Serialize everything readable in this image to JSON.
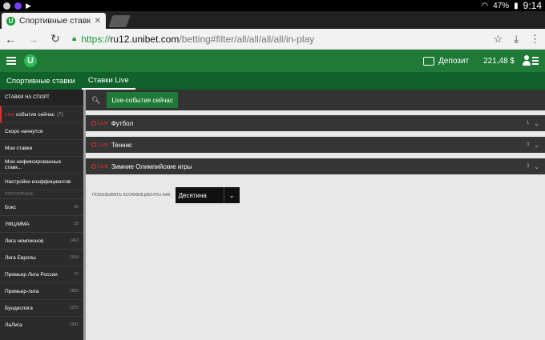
{
  "statusbar": {
    "battery": "47%",
    "time": "9:14"
  },
  "browser": {
    "tab_title": "Спортивные ставки U",
    "url_scheme": "https://",
    "url_host": "ru12.unibet.com",
    "url_path": "/betting#filter/all/all/all/all/in-play"
  },
  "app": {
    "logo": "U",
    "deposit_label": "Депозит",
    "balance": "221,48 $"
  },
  "subnav": {
    "items": [
      {
        "label": "Спортивные ставки"
      },
      {
        "label": "Ставки Live"
      }
    ]
  },
  "sidebar": {
    "header": "СТАВКИ НА СПОРТ",
    "live_prefix": "Live",
    "current_label": "события сейчас",
    "current_count": "(7)",
    "items": [
      {
        "label": "Скоро начнутся"
      },
      {
        "label": "Мои ставки"
      },
      {
        "label": "Мои нефиксированные ставк..."
      },
      {
        "label": "Настройки коэффициентов"
      }
    ],
    "section_label": "ПОПУЛЯРНЫЕ",
    "popular": [
      {
        "label": "Бокс",
        "count": "30"
      },
      {
        "label": "УФЦ/ММА",
        "count": "15"
      },
      {
        "label": "Лига чемпионов",
        "count": "1462"
      },
      {
        "label": "Лига Европы",
        "count": "2644"
      },
      {
        "label": "Премьер Лига России",
        "count": "22"
      },
      {
        "label": "Премьер-лига",
        "count": "2809"
      },
      {
        "label": "Бундеслига",
        "count": "1375"
      },
      {
        "label": "ЛаЛига",
        "count": "1991"
      }
    ]
  },
  "main": {
    "filter_chip": "Live-события сейчас",
    "live_label": "Live",
    "events": [
      {
        "name": "Футбол",
        "count": "1"
      },
      {
        "name": "Теннис",
        "count": "3"
      },
      {
        "name": "Зимние Олимпийские игры",
        "count": "3"
      }
    ],
    "odds_label": "ПОКАЗЫВАТЬ КОЭФФИЦИЕНТЫ КАК",
    "odds_value": "Десятина"
  },
  "colors": {
    "brand_green": "#1f7a37",
    "live_red": "#e03030"
  }
}
